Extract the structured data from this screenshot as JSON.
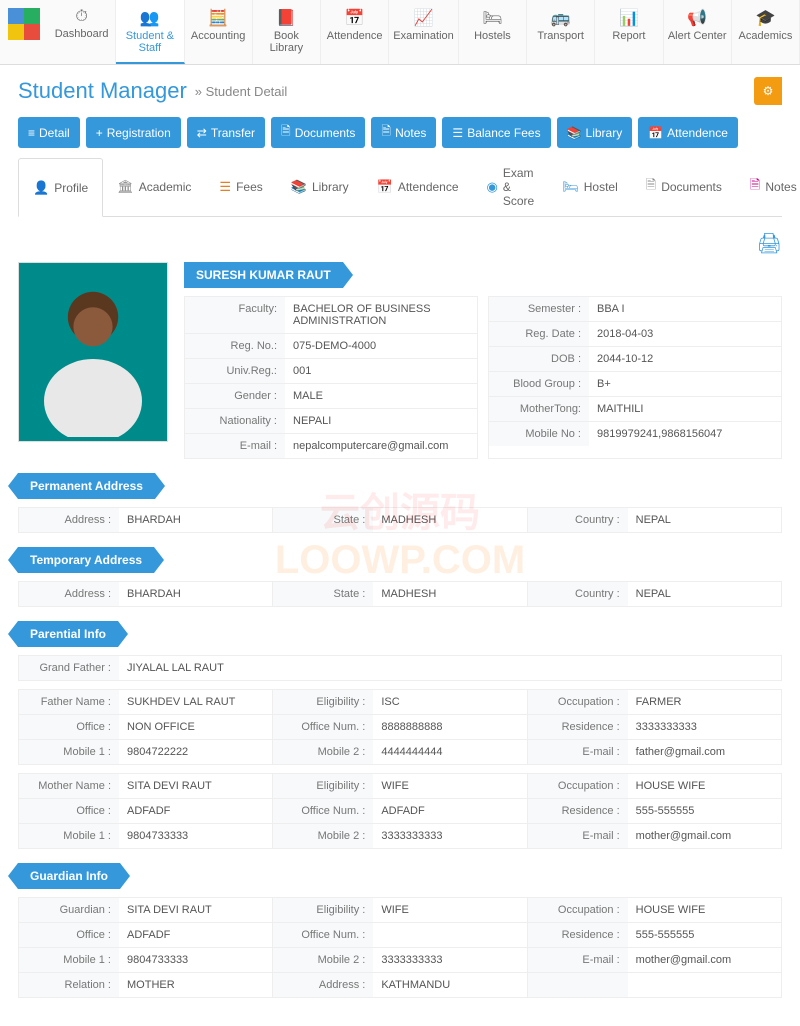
{
  "topnav": [
    {
      "label": "Dashboard",
      "icon": "⏱"
    },
    {
      "label": "Student & Staff",
      "icon": "👥",
      "active": true
    },
    {
      "label": "Accounting",
      "icon": "🧮"
    },
    {
      "label": "Book Library",
      "icon": "📕"
    },
    {
      "label": "Attendence",
      "icon": "📅"
    },
    {
      "label": "Examination",
      "icon": "📈"
    },
    {
      "label": "Hostels",
      "icon": "🛏"
    },
    {
      "label": "Transport",
      "icon": "🚌"
    },
    {
      "label": "Report",
      "icon": "📊"
    },
    {
      "label": "Alert Center",
      "icon": "📢"
    },
    {
      "label": "Academics",
      "icon": "🎓"
    }
  ],
  "header": {
    "title": "Student Manager",
    "breadcrumb": "» Student Detail"
  },
  "actions": [
    {
      "label": "Detail",
      "icon": "≡"
    },
    {
      "label": "Registration",
      "icon": "+"
    },
    {
      "label": "Transfer",
      "icon": "⇄"
    },
    {
      "label": "Documents",
      "icon": "🗎"
    },
    {
      "label": "Notes",
      "icon": "🗎"
    },
    {
      "label": "Balance Fees",
      "icon": "☰"
    },
    {
      "label": "Library",
      "icon": "📚"
    },
    {
      "label": "Attendence",
      "icon": "📅"
    }
  ],
  "tabs": [
    {
      "label": "Profile",
      "icon": "👤",
      "color": "#27ae60",
      "active": true
    },
    {
      "label": "Academic",
      "icon": "🏛",
      "color": "#888"
    },
    {
      "label": "Fees",
      "icon": "☰",
      "color": "#e67e22"
    },
    {
      "label": "Library",
      "icon": "📚",
      "color": "#c0392b"
    },
    {
      "label": "Attendence",
      "icon": "📅",
      "color": "#3498db"
    },
    {
      "label": "Exam & Score",
      "icon": "◉",
      "color": "#3498db"
    },
    {
      "label": "Hostel",
      "icon": "🛏",
      "color": "#3498db"
    },
    {
      "label": "Documents",
      "icon": "🗎",
      "color": "#888"
    },
    {
      "label": "Notes",
      "icon": "🗎",
      "color": "#c08"
    }
  ],
  "student": {
    "name": "SURESH KUMAR RAUT",
    "left": [
      {
        "k": "Faculty:",
        "v": "BACHELOR OF BUSINESS ADMINISTRATION"
      },
      {
        "k": "Reg. No.:",
        "v": "075-DEMO-4000"
      },
      {
        "k": "Univ.Reg.:",
        "v": "001"
      },
      {
        "k": "Gender :",
        "v": "MALE"
      },
      {
        "k": "Nationality :",
        "v": "NEPALI"
      },
      {
        "k": "E-mail :",
        "v": "nepalcomputercare@gmail.com"
      }
    ],
    "right": [
      {
        "k": "Semester :",
        "v": "BBA I"
      },
      {
        "k": "Reg. Date :",
        "v": "2018-04-03"
      },
      {
        "k": "DOB :",
        "v": "2044-10-12"
      },
      {
        "k": "Blood Group :",
        "v": "B+"
      },
      {
        "k": "MotherTong:",
        "v": "MAITHILI"
      },
      {
        "k": "Mobile No :",
        "v": "9819979241,9868156047"
      }
    ]
  },
  "sections": {
    "permAddr": {
      "title": "Permanent Address",
      "rows": [
        [
          {
            "k": "Address :",
            "v": "BHARDAH"
          },
          {
            "k": "State :",
            "v": "MADHESH"
          },
          {
            "k": "Country :",
            "v": "NEPAL"
          }
        ]
      ]
    },
    "tempAddr": {
      "title": "Temporary Address",
      "rows": [
        [
          {
            "k": "Address :",
            "v": "BHARDAH"
          },
          {
            "k": "State :",
            "v": "MADHESH"
          },
          {
            "k": "Country :",
            "v": "NEPAL"
          }
        ]
      ]
    },
    "parential": {
      "title": "Parential Info",
      "grandfather": [
        [
          {
            "k": "Grand Father :",
            "v": "JIYALAL LAL RAUT"
          }
        ]
      ],
      "father": [
        [
          {
            "k": "Father Name :",
            "v": "SUKHDEV LAL RAUT"
          },
          {
            "k": "Eligibility :",
            "v": "ISC"
          },
          {
            "k": "Occupation :",
            "v": "FARMER"
          }
        ],
        [
          {
            "k": "Office :",
            "v": "NON OFFICE"
          },
          {
            "k": "Office Num. :",
            "v": "8888888888"
          },
          {
            "k": "Residence :",
            "v": "3333333333"
          }
        ],
        [
          {
            "k": "Mobile 1 :",
            "v": "9804722222"
          },
          {
            "k": "Mobile 2 :",
            "v": "4444444444"
          },
          {
            "k": "E-mail :",
            "v": "father@gmail.com"
          }
        ]
      ],
      "mother": [
        [
          {
            "k": "Mother Name :",
            "v": "SITA DEVI RAUT"
          },
          {
            "k": "Eligibility :",
            "v": "WIFE"
          },
          {
            "k": "Occupation :",
            "v": "HOUSE WIFE"
          }
        ],
        [
          {
            "k": "Office :",
            "v": "ADFADF"
          },
          {
            "k": "Office Num. :",
            "v": "ADFADF"
          },
          {
            "k": "Residence :",
            "v": "555-555555"
          }
        ],
        [
          {
            "k": "Mobile 1 :",
            "v": "9804733333"
          },
          {
            "k": "Mobile 2 :",
            "v": "3333333333"
          },
          {
            "k": "E-mail :",
            "v": "mother@gmail.com"
          }
        ]
      ]
    },
    "guardian": {
      "title": "Guardian Info",
      "rows": [
        [
          {
            "k": "Guardian :",
            "v": "SITA DEVI RAUT"
          },
          {
            "k": "Eligibility :",
            "v": "WIFE"
          },
          {
            "k": "Occupation :",
            "v": "HOUSE WIFE"
          }
        ],
        [
          {
            "k": "Office :",
            "v": "ADFADF"
          },
          {
            "k": "Office Num. :",
            "v": ""
          },
          {
            "k": "Residence :",
            "v": "555-555555"
          }
        ],
        [
          {
            "k": "Mobile 1 :",
            "v": "9804733333"
          },
          {
            "k": "Mobile 2 :",
            "v": "3333333333"
          },
          {
            "k": "E-mail :",
            "v": "mother@gmail.com"
          }
        ],
        [
          {
            "k": "Relation :",
            "v": "MOTHER"
          },
          {
            "k": "Address :",
            "v": "KATHMANDU"
          },
          {
            "k": "",
            "v": ""
          }
        ]
      ]
    }
  },
  "watermark": {
    "line1": "云创源码",
    "line2": "LOOWP.COM"
  }
}
